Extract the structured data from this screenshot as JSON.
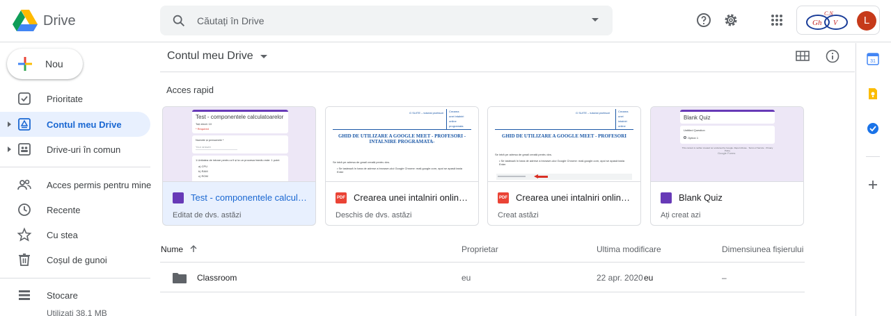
{
  "header": {
    "app_name": "Drive",
    "search_placeholder": "Căutați în Drive",
    "avatar_letter": "L"
  },
  "sidebar": {
    "new_label": "Nou",
    "items": [
      {
        "label": "Prioritate",
        "icon": "priority-checkbox-icon"
      },
      {
        "label": "Contul meu Drive",
        "icon": "my-drive-icon",
        "active": true
      },
      {
        "label": "Drive-uri în comun",
        "icon": "shared-drives-icon"
      },
      {
        "label": "Acces permis pentru mine",
        "icon": "shared-with-me-icon"
      },
      {
        "label": "Recente",
        "icon": "clock-icon"
      },
      {
        "label": "Cu stea",
        "icon": "star-icon"
      },
      {
        "label": "Coșul de gunoi",
        "icon": "trash-icon"
      },
      {
        "label": "Stocare",
        "icon": "storage-icon"
      }
    ],
    "storage_used": "Utilizati 38.1 MB"
  },
  "main": {
    "breadcrumb": "Contul meu Drive",
    "quick_access_title": "Acces rapid",
    "cards": [
      {
        "title": "Test - componentele calculatoarelor",
        "subtitle": "Editat de dvs. astăzi",
        "type": "form",
        "thumb_title": "Test - componentele calculatoarelor",
        "thumb_lines": [
          "Toți elevii: 10",
          "* Required",
          "Numele și prenumele *",
          "Your answer",
          "1.Unitatea de intrare pentru a fi și la un procesor/mediu este: 1 point",
          "a) CPU",
          "b) RAM",
          "c) ROM"
        ]
      },
      {
        "title": "Crearea unei intalniri online pr...",
        "subtitle": "Deschis de dvs. astăzi",
        "type": "pdf",
        "thumb_header": "G SUITE – tutorial profesori",
        "thumb_side": [
          "Crearea",
          "unei intalniri",
          "online",
          "programata"
        ],
        "thumb_title": "GHID DE UTILIZARE A GOOGLE MEET - PROFESORI -INTALNIRE PROGRAMATA-",
        "thumb_body": [
          "Se intră pe adresa de gmail creată pentru dvs.",
          "• Se tastează în bara de adrese a browser-ului Google Chrome: mail.google.com, apoi se apasă tasta Enter"
        ]
      },
      {
        "title": "Crearea unei intalniri online c...",
        "subtitle": "Creat astăzi",
        "type": "pdf",
        "thumb_header": "G SUITE – tutorial profesori",
        "thumb_side": [
          "Crearea",
          "unei",
          "intalniri",
          "online"
        ],
        "thumb_title": "GHID DE UTILIZARE A GOOGLE MEET - PROFESORI",
        "thumb_body": [
          "Se intră pe adresa de gmail creată pentru dvs.",
          "• Se tastează în bara de adrese a browser-ului Google Chrome: mail.google.com, apoi se apasă tasta Enter"
        ]
      },
      {
        "title": "Blank Quiz",
        "subtitle": "Ați creat azi",
        "type": "form",
        "thumb_title": "Blank Quiz",
        "thumb_lines": [
          "Untitled Question",
          "Option 1",
          "This content is neither created nor endorsed by Google. Report Abuse · Terms of Service · Privacy Policy",
          "Google Forms"
        ]
      }
    ],
    "table": {
      "headers": [
        "Nume",
        "Proprietar",
        "Ultima modificare",
        "Dimensiunea fișierului"
      ],
      "rows": [
        {
          "name": "Classroom",
          "owner": "eu",
          "modified": "22 apr. 2020",
          "modified_by": "eu",
          "size": "–"
        }
      ]
    }
  },
  "colors": {
    "accent_blue": "#1967d2",
    "active_bg": "#e8f0fe",
    "form_purple": "#673ab7",
    "pdf_red": "#ea4335",
    "avatar_bg": "#c63a1a"
  }
}
